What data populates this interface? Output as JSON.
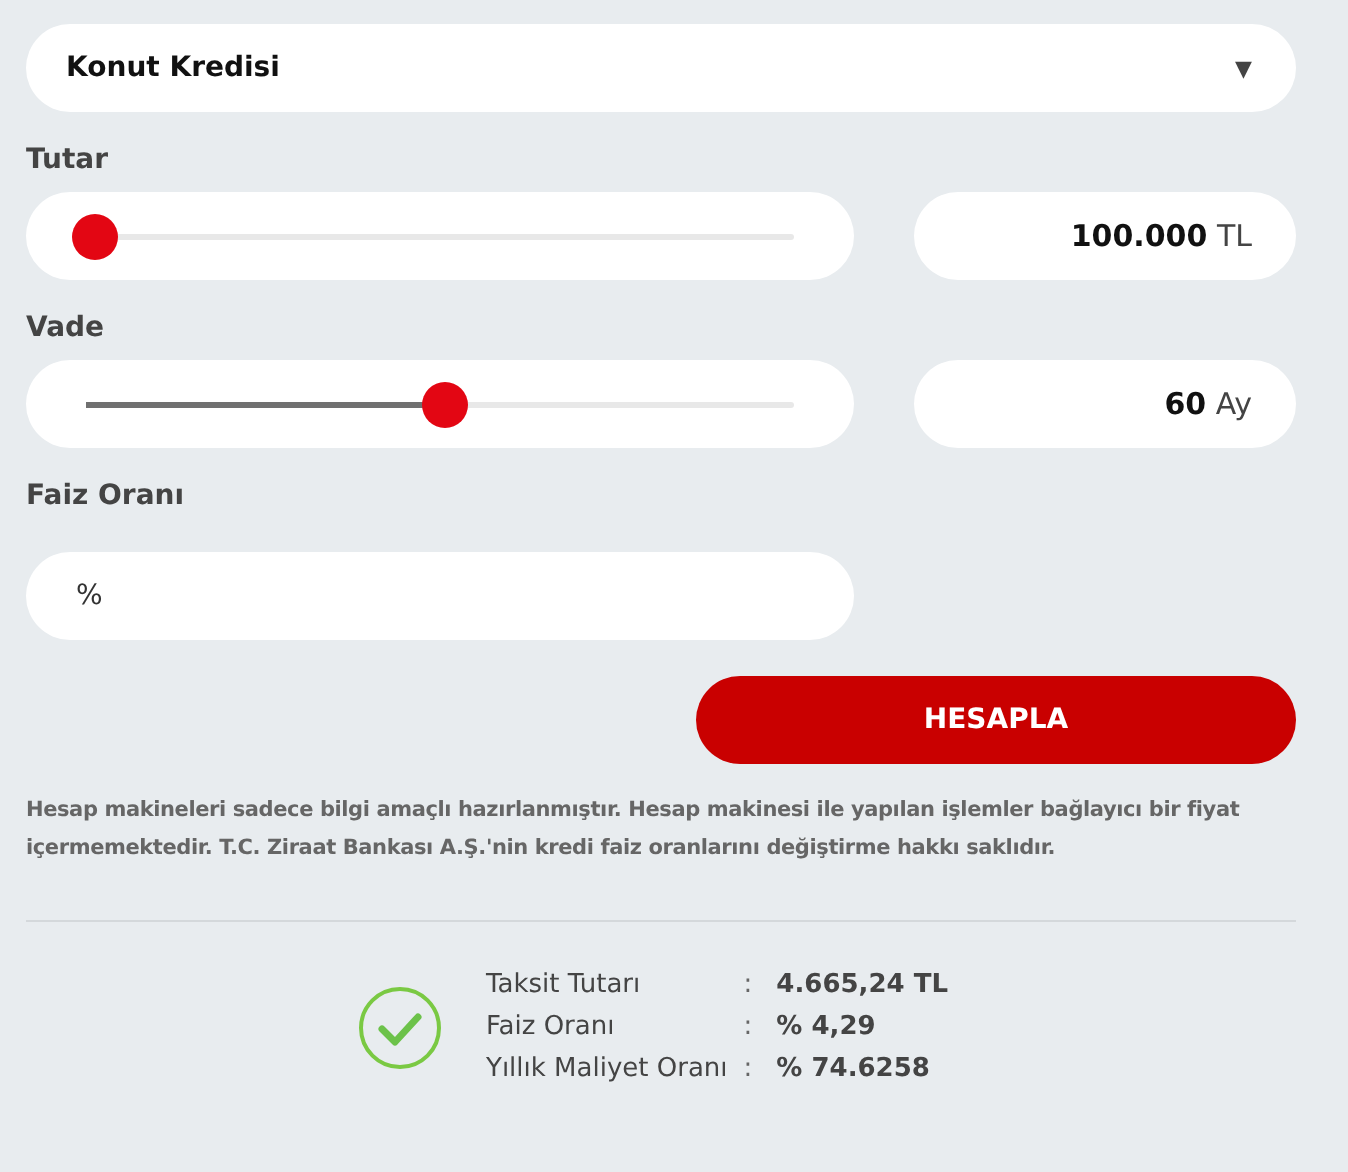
{
  "loan_type": {
    "value": "Konut Kredisi",
    "caret": "▼"
  },
  "sliders": [
    {
      "label": "Tutar",
      "level": 0,
      "value": "100.000",
      "unit": "TL"
    },
    {
      "label": "Vade",
      "level": 0.5,
      "value": "60",
      "unit": "Ay"
    }
  ],
  "interest": {
    "label": "Faiz Oranı",
    "placeholder": "%"
  },
  "calculate_button": "HESAPLA",
  "disclaimer": "Hesap makineleri sadece bilgi amaçlı hazırlanmıştır. Hesap makinesi ile yapılan işlemler bağlayıcı bir fiyat içermemektedir. T.C. Ziraat Bankası A.Ş.'nin kredi faiz oranlarını değiştirme hakkı saklıdır.",
  "results": [
    {
      "label": "Taksit Tutarı",
      "separator": ":",
      "value": "4.665,24 TL"
    },
    {
      "label": "Faiz Oranı",
      "separator": ":",
      "value": "% 4,29"
    },
    {
      "label": "Yıllık Maliyet Oranı",
      "separator": ":",
      "value": "% 74.6258"
    }
  ]
}
